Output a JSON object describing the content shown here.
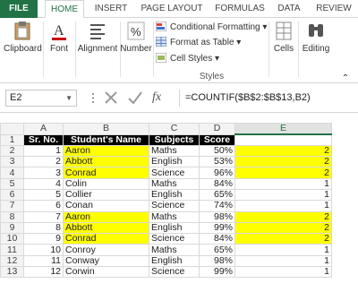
{
  "ribbon_tabs": [
    "FILE",
    "HOME",
    "INSERT",
    "PAGE LAYOUT",
    "FORMULAS",
    "DATA",
    "REVIEW"
  ],
  "ribbon": {
    "clipboard": "Clipboard",
    "font": "Font",
    "alignment": "Alignment",
    "number": "Number",
    "conditional_formatting": "Conditional Formatting",
    "format_as_table": "Format as Table",
    "cell_styles": "Cell Styles",
    "styles_group": "Styles",
    "cells": "Cells",
    "editing": "Editing"
  },
  "formula_bar": {
    "name_box": "E2",
    "fx": "fx",
    "formula": "=COUNTIF($B$2:$B$13,B2)"
  },
  "columns": [
    "A",
    "B",
    "C",
    "D",
    "E"
  ],
  "selected_column": "E",
  "header_row": {
    "row": "1",
    "cells": [
      "Sr. No.",
      "Student's Name",
      "Subjects",
      "Score",
      ""
    ]
  },
  "rows": [
    {
      "row": "2",
      "sr": "1",
      "name": "Aaron",
      "subject": "Maths",
      "score": "50%",
      "count": "2",
      "highlight": true
    },
    {
      "row": "3",
      "sr": "2",
      "name": "Abbott",
      "subject": "English",
      "score": "53%",
      "count": "2",
      "highlight": true
    },
    {
      "row": "4",
      "sr": "3",
      "name": "Conrad",
      "subject": "Science",
      "score": "96%",
      "count": "2",
      "highlight": true
    },
    {
      "row": "5",
      "sr": "4",
      "name": "Colin",
      "subject": "Maths",
      "score": "84%",
      "count": "1",
      "highlight": false
    },
    {
      "row": "6",
      "sr": "5",
      "name": "Collier",
      "subject": "English",
      "score": "65%",
      "count": "1",
      "highlight": false
    },
    {
      "row": "7",
      "sr": "6",
      "name": "Conan",
      "subject": "Science",
      "score": "74%",
      "count": "1",
      "highlight": false
    },
    {
      "row": "8",
      "sr": "7",
      "name": "Aaron",
      "subject": "Maths",
      "score": "98%",
      "count": "2",
      "highlight": true
    },
    {
      "row": "9",
      "sr": "8",
      "name": "Abbott",
      "subject": "English",
      "score": "99%",
      "count": "2",
      "highlight": true
    },
    {
      "row": "10",
      "sr": "9",
      "name": "Conrad",
      "subject": "Science",
      "score": "84%",
      "count": "2",
      "highlight": true
    },
    {
      "row": "11",
      "sr": "10",
      "name": "Conroy",
      "subject": "Maths",
      "score": "65%",
      "count": "1",
      "highlight": false
    },
    {
      "row": "12",
      "sr": "11",
      "name": "Conway",
      "subject": "English",
      "score": "98%",
      "count": "1",
      "highlight": false
    },
    {
      "row": "13",
      "sr": "12",
      "name": "Corwin",
      "subject": "Science",
      "score": "99%",
      "count": "1",
      "highlight": false
    }
  ],
  "colors": {
    "accent": "#217346",
    "highlight": "#ffff00",
    "header_bg": "#000000"
  }
}
